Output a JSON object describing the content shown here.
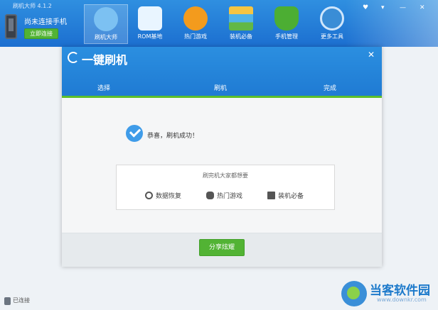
{
  "app": {
    "title": "刷机大师 4.1.2"
  },
  "device": {
    "status": "尚未连接手机",
    "connect_button": "立即连接"
  },
  "nav": [
    {
      "label": "刷机大师",
      "icon": "cloud-icon",
      "active": true
    },
    {
      "label": "ROM基地",
      "icon": "shopping-bag-icon"
    },
    {
      "label": "热门游戏",
      "icon": "gamepad-icon"
    },
    {
      "label": "装机必备",
      "icon": "package-icon"
    },
    {
      "label": "手机管理",
      "icon": "shield-phone-icon"
    },
    {
      "label": "更多工具",
      "icon": "wrench-icon"
    }
  ],
  "window_controls": {
    "skin": "♥",
    "menu": "▾",
    "minimize": "—",
    "close": "✕"
  },
  "modal": {
    "title": "一键刷机",
    "close": "✕",
    "steps": [
      "选择",
      "刷机",
      "完成"
    ],
    "success_message": "恭喜，刷机成功！",
    "suggest_title": "刷完机大家都想要",
    "suggestions": [
      {
        "label": "数据恢复",
        "icon": "restore-icon"
      },
      {
        "label": "热门游戏",
        "icon": "gamepad-icon"
      },
      {
        "label": "装机必备",
        "icon": "box-icon"
      }
    ],
    "share_button": "分享炫耀"
  },
  "status": {
    "text": "已连接"
  },
  "watermark": {
    "text": "当客软件园",
    "url": "www.downkr.com"
  },
  "colors": {
    "primary_blue": "#1f7ad3",
    "accent_green": "#52b334"
  }
}
